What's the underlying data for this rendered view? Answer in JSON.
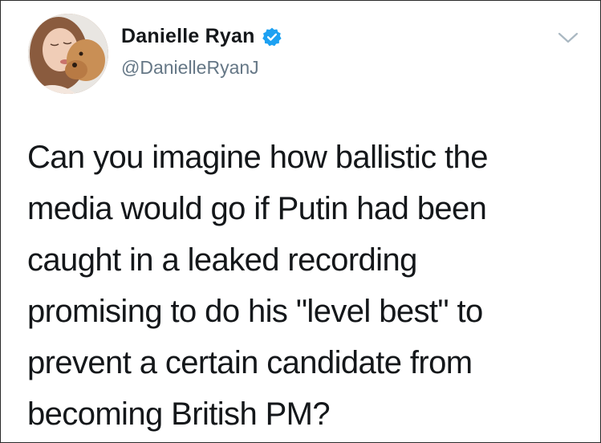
{
  "author": {
    "display_name": "Danielle Ryan",
    "handle": "@DanielleRyanJ",
    "verified": true,
    "avatar_icon": "profile-photo",
    "verified_icon": "verified-badge-icon",
    "verified_color": "#1da1f2"
  },
  "menu": {
    "icon": "chevron-down-icon",
    "color": "#aab8c2"
  },
  "tweet": {
    "lines": [
      "Can you imagine how ballistic the",
      "media would go if Putin had been",
      "caught in a leaked recording",
      "promising to do his \"level best\" to",
      "prevent a certain candidate from",
      "becoming British PM?"
    ]
  }
}
